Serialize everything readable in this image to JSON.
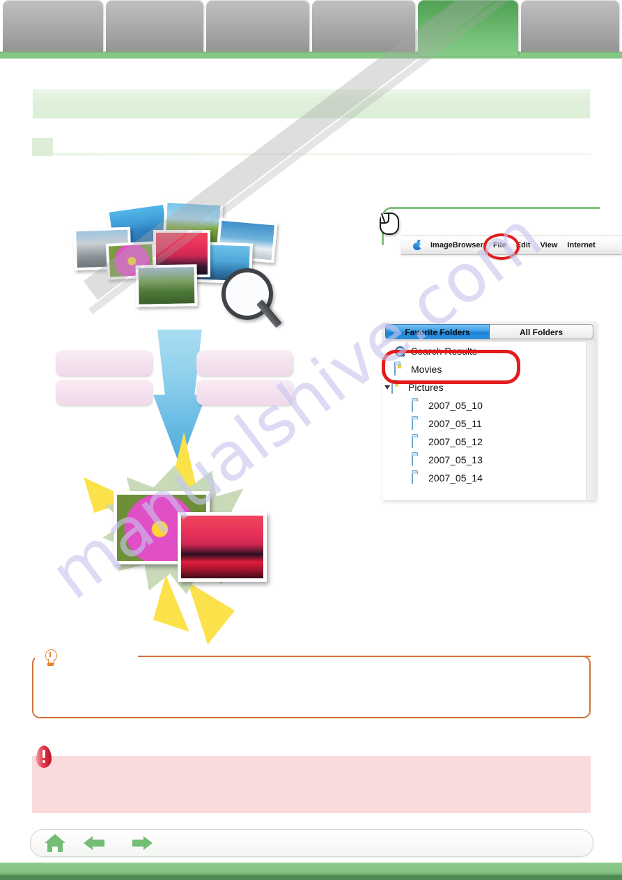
{
  "tabs": [
    {
      "label": "",
      "active": false
    },
    {
      "label": "",
      "active": false
    },
    {
      "label": "",
      "active": false
    },
    {
      "label": "",
      "active": false
    },
    {
      "label": "",
      "active": true
    },
    {
      "label": "",
      "active": false
    }
  ],
  "header": {
    "title": ""
  },
  "section": {
    "heading": ""
  },
  "illustration": {
    "photos": [
      "sea",
      "hut",
      "building",
      "bird",
      "sunset",
      "flower",
      "whale",
      "cyclists"
    ],
    "magnifier_icon": "magnifier-icon",
    "arrow_icon": "down-arrow",
    "labels": [
      "",
      "",
      "",
      ""
    ],
    "results": [
      "flower-photo",
      "sunset-photo"
    ]
  },
  "callout": {
    "mouse_icon": "mouse-icon",
    "menubar": {
      "apple_icon": "apple-logo",
      "app_name": "ImageBrowser",
      "items": [
        "File",
        "Edit",
        "View",
        "Internet"
      ],
      "highlighted_item": "File"
    }
  },
  "folder_panel": {
    "tabs": [
      {
        "label": "Favorite Folders",
        "selected": true
      },
      {
        "label": "All Folders",
        "selected": false
      }
    ],
    "items": [
      {
        "label": "Search Results",
        "icon": "search-icon",
        "indent": 0,
        "highlighted": true
      },
      {
        "label": "Movies",
        "icon": "favorite-folder-icon",
        "indent": 0,
        "highlighted": false
      },
      {
        "label": "Pictures",
        "icon": "favorite-folder-icon",
        "indent": 0,
        "expanded": true,
        "highlighted": false
      },
      {
        "label": "2007_05_10",
        "icon": "folder-icon",
        "indent": 1,
        "highlighted": false
      },
      {
        "label": "2007_05_11",
        "icon": "folder-icon",
        "indent": 1,
        "highlighted": false
      },
      {
        "label": "2007_05_12",
        "icon": "folder-icon",
        "indent": 1,
        "highlighted": false
      },
      {
        "label": "2007_05_13",
        "icon": "folder-icon",
        "indent": 1,
        "highlighted": false
      },
      {
        "label": "2007_05_14",
        "icon": "folder-icon",
        "indent": 1,
        "highlighted": false
      }
    ]
  },
  "tip_box": {
    "icon": "lightbulb-icon",
    "label": "",
    "text": ""
  },
  "caution_box": {
    "icon": "caution-icon",
    "text": ""
  },
  "footer": {
    "home_icon": "home-icon",
    "back_icon": "back-arrow-icon",
    "forward_icon": "forward-arrow-icon"
  },
  "watermark": {
    "text": "manualshive.com"
  },
  "colors": {
    "active_tab_green": "#5cab5f",
    "tab_gray": "#b4b4b4",
    "banner_green": "#e0f0db",
    "highlight_red": "#e41b1b",
    "panel_tab_blue": "#3f9fe8",
    "tip_orange": "#d2703a",
    "caution_pink": "#fadbdb",
    "footer_green": "#83c483",
    "arrow_blue": "#62b8e2",
    "label_pink": "#f4e1ee"
  }
}
